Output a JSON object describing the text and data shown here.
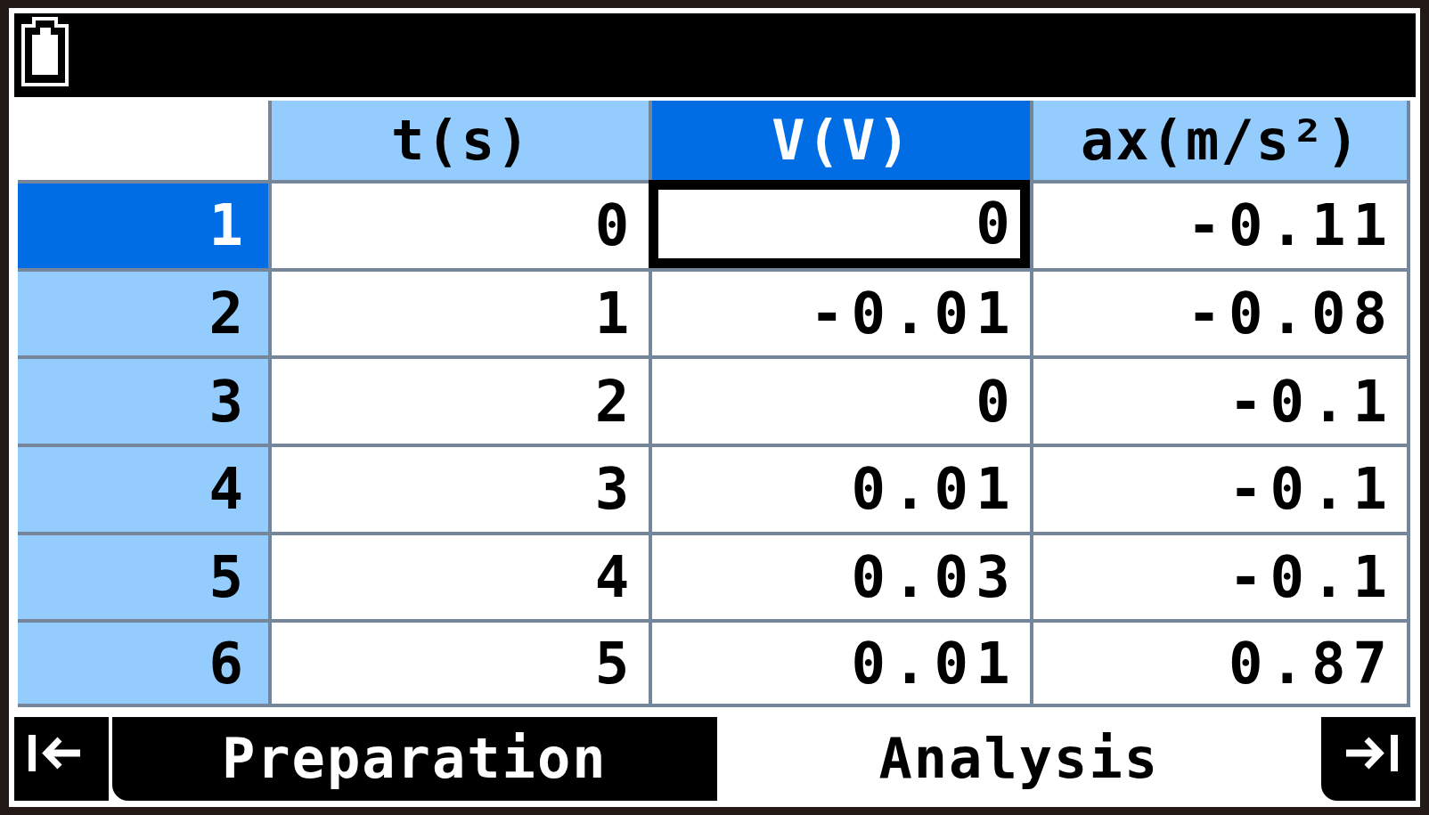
{
  "table": {
    "columns": [
      {
        "label": "t(s)",
        "selected": false
      },
      {
        "label": "V(V)",
        "selected": true
      },
      {
        "label": "ax(m/s²)",
        "selected": false
      }
    ],
    "rows": [
      {
        "label": "1",
        "selected": true,
        "cells": [
          {
            "value": "0",
            "selected": false
          },
          {
            "value": "0",
            "selected": true
          },
          {
            "value": "-0.11",
            "selected": false
          }
        ]
      },
      {
        "label": "2",
        "selected": false,
        "cells": [
          {
            "value": "1",
            "selected": false
          },
          {
            "value": "-0.01",
            "selected": false
          },
          {
            "value": "-0.08",
            "selected": false
          }
        ]
      },
      {
        "label": "3",
        "selected": false,
        "cells": [
          {
            "value": "2",
            "selected": false
          },
          {
            "value": "0",
            "selected": false
          },
          {
            "value": "-0.1",
            "selected": false
          }
        ]
      },
      {
        "label": "4",
        "selected": false,
        "cells": [
          {
            "value": "3",
            "selected": false
          },
          {
            "value": "0.01",
            "selected": false
          },
          {
            "value": "-0.1",
            "selected": false
          }
        ]
      },
      {
        "label": "5",
        "selected": false,
        "cells": [
          {
            "value": "4",
            "selected": false
          },
          {
            "value": "0.03",
            "selected": false
          },
          {
            "value": "-0.1",
            "selected": false
          }
        ]
      },
      {
        "label": "6",
        "selected": false,
        "cells": [
          {
            "value": "5",
            "selected": false
          },
          {
            "value": "0.01",
            "selected": false
          },
          {
            "value": "0.87",
            "selected": false
          }
        ]
      }
    ]
  },
  "tabs": [
    {
      "label": "Preparation",
      "selected": false
    },
    {
      "label": "Analysis",
      "selected": true
    }
  ]
}
